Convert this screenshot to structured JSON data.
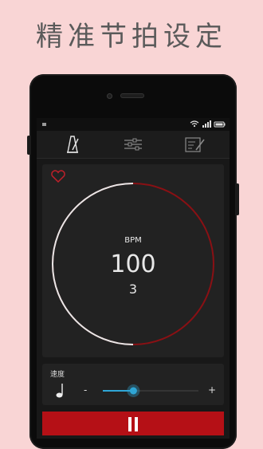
{
  "headline": "精准节拍设定",
  "colors": {
    "background": "#f9d5d5",
    "accent_red": "#8a1014",
    "play_red": "#b51016",
    "slider_blue": "#2fa6d6"
  },
  "toolbar": {
    "icons": [
      "metronome-icon",
      "equalizer-icon",
      "edit-note-icon"
    ]
  },
  "bpm_dial": {
    "label": "BPM",
    "value": "100",
    "beats": "3",
    "progress_fraction": 0.5
  },
  "speed": {
    "label": "速度",
    "minus": "-",
    "plus": "+",
    "level_fraction": 0.32
  },
  "favorite_icon": "heart-icon",
  "play_icon": "pause-icon"
}
